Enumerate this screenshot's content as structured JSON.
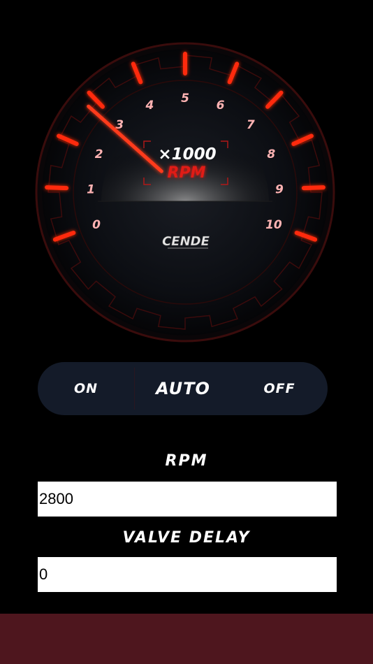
{
  "gauge": {
    "numbers": [
      "0",
      "1",
      "2",
      "3",
      "4",
      "5",
      "6",
      "7",
      "8",
      "9",
      "10"
    ],
    "multiplier": "×1000",
    "unit": "RPM",
    "logo": "CENDE",
    "needle_value": 2.8,
    "max_value": 10,
    "accent_color": "#ff2a10"
  },
  "mode": {
    "on_label": "ON",
    "auto_label": "AUTO",
    "off_label": "OFF",
    "selected": "AUTO"
  },
  "rpm": {
    "label": "RPM",
    "value": "2800"
  },
  "valve_delay": {
    "label": "VALVE DELAY",
    "value": "0"
  },
  "colors": {
    "background": "#000000",
    "toggle_bg": "#141b29",
    "bottom_bar": "#4e161e"
  }
}
